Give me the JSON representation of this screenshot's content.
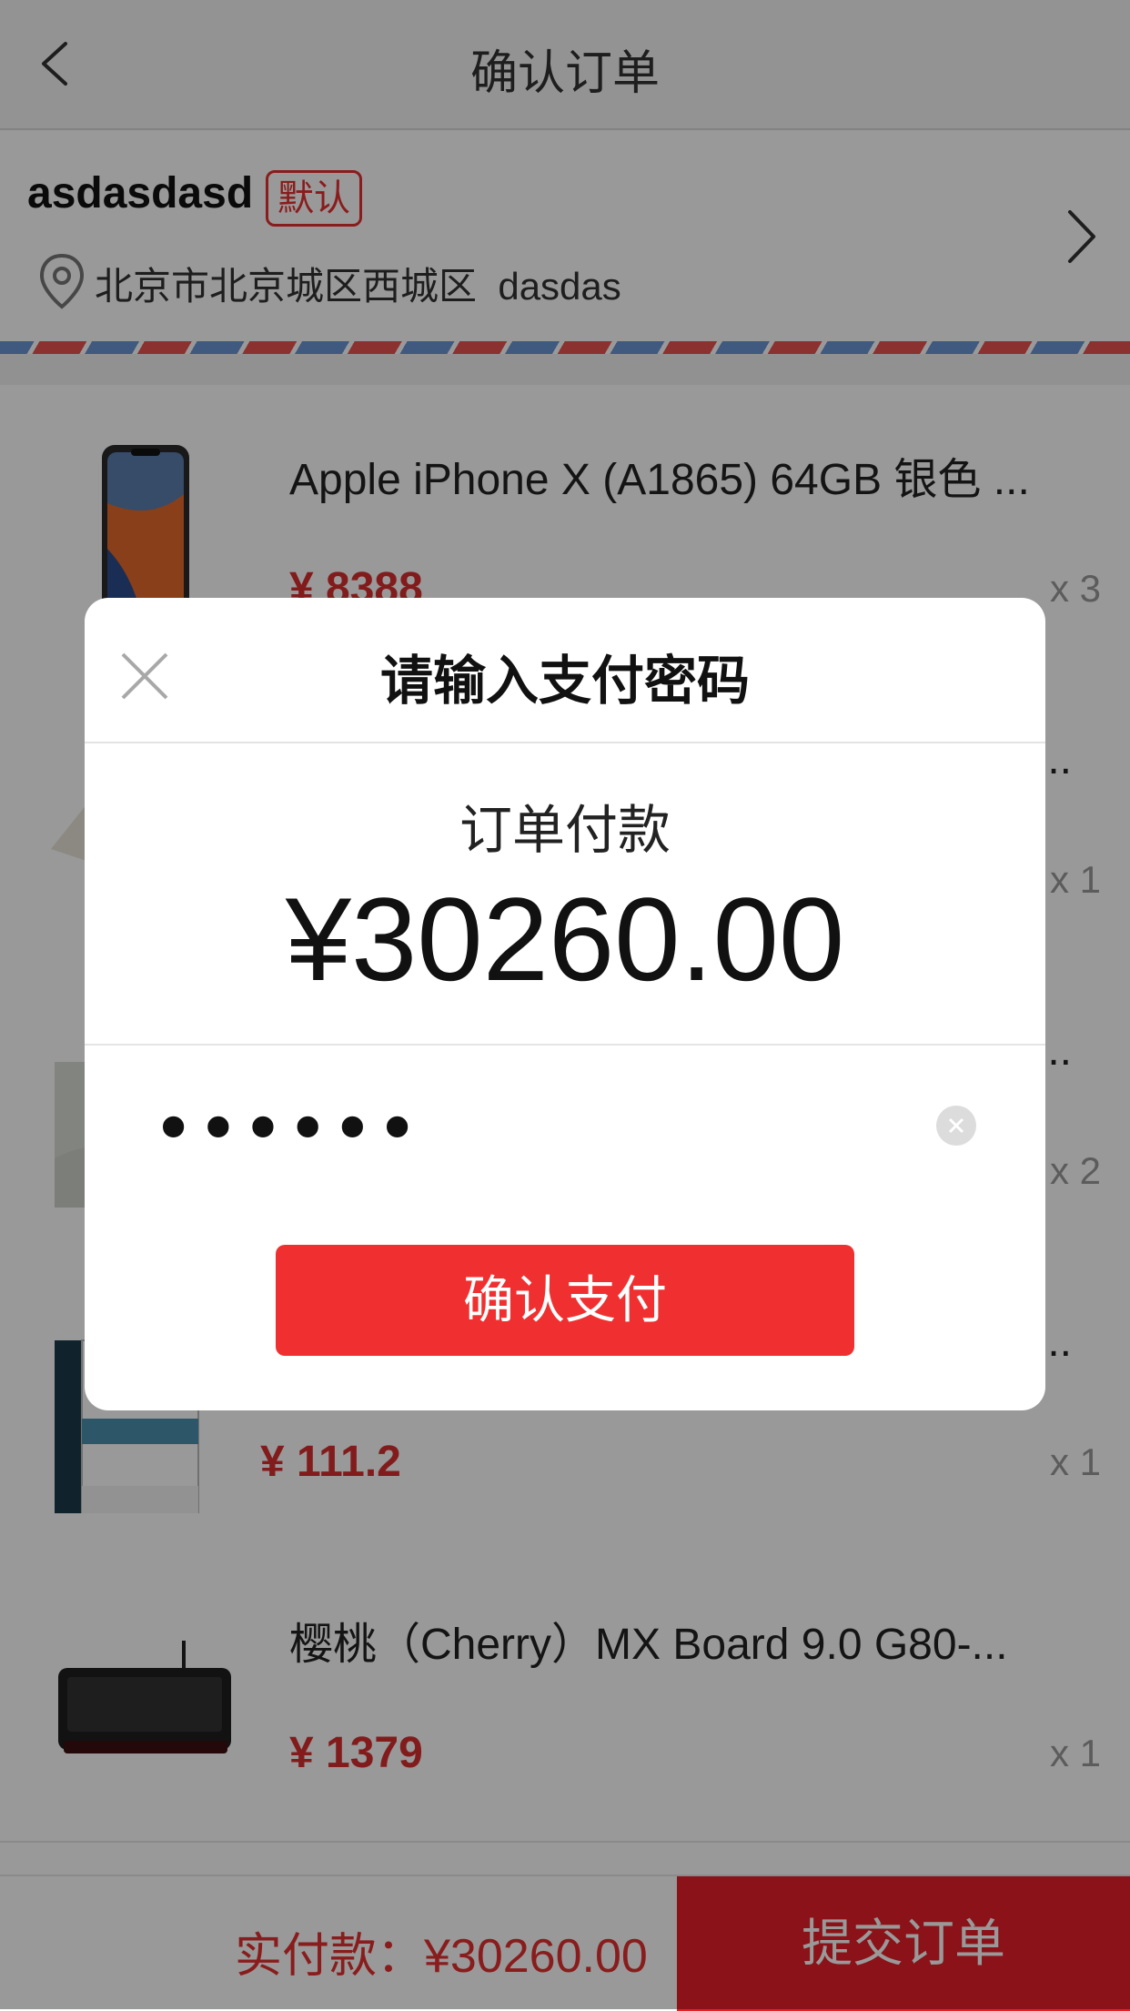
{
  "header": {
    "title": "确认订单"
  },
  "address": {
    "name": "asdasdasd",
    "badge": "默认",
    "text": "北京市北京城区西城区  dasdas"
  },
  "products": [
    {
      "title": "Apple iPhone X (A1865) 64GB 银色 ...",
      "price": "¥ 8388",
      "qty": "x 3"
    },
    {
      "title": "...",
      "price": "",
      "qty": "x 1"
    },
    {
      "title": "...",
      "price": "",
      "qty": "x 2"
    },
    {
      "title": "...",
      "price": "¥ 111.2",
      "qty": "x 1"
    },
    {
      "title": "樱桃（Cherry）MX Board 9.0 G80-...",
      "price": "¥ 1379",
      "qty": "x 1"
    }
  ],
  "bottom": {
    "total": "实付款：¥30260.00",
    "submit": "提交订单"
  },
  "dialog": {
    "title": "请输入支付密码",
    "pay_label": "订单付款",
    "amount": "¥30260.00",
    "password_value": "••••••",
    "confirm": "确认支付"
  },
  "colors": {
    "accent": "#f03030",
    "submit": "#e61e28",
    "price": "#d93030"
  }
}
